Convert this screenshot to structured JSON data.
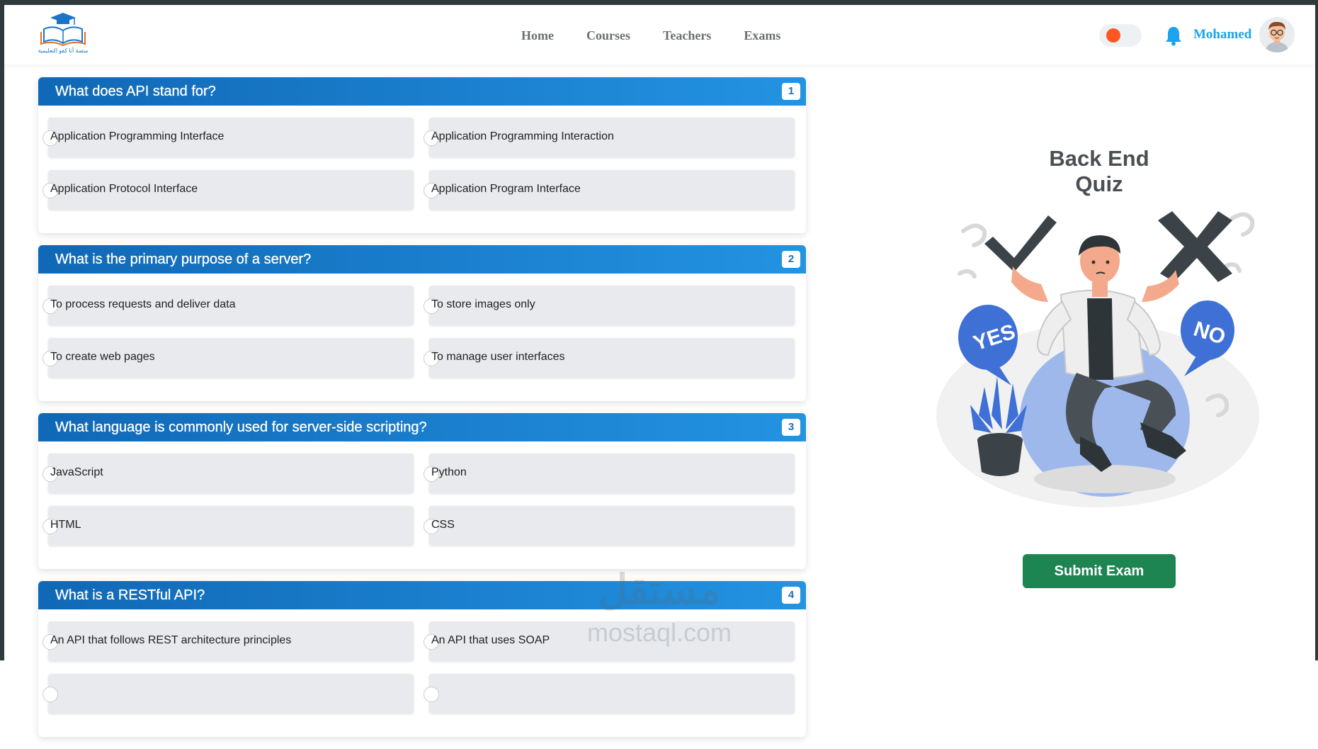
{
  "brand": {
    "logo_text": "منصة أنا كفو التعليمية"
  },
  "nav": {
    "items": [
      {
        "label": "Home"
      },
      {
        "label": "Courses"
      },
      {
        "label": "Teachers"
      },
      {
        "label": "Exams"
      }
    ]
  },
  "user": {
    "name": "Mohamed"
  },
  "colors": {
    "accent": "#1aa3ee",
    "header_gradient_start": "#1068b6",
    "header_gradient_end": "#2393e2",
    "submit": "#1d8551",
    "toggle_knob": "#ff5722"
  },
  "questions": [
    {
      "number": "1",
      "title": "What does API stand for?",
      "options": [
        "Application Programming Interface",
        "Application Programming Interaction",
        "Application Protocol Interface",
        "Application Program Interface"
      ]
    },
    {
      "number": "2",
      "title": "What is the primary purpose of a server?",
      "options": [
        "To process requests and deliver data",
        "To store images only",
        "To create web pages",
        "To manage user interfaces"
      ]
    },
    {
      "number": "3",
      "title": "What language is commonly used for server-side scripting?",
      "options": [
        "JavaScript",
        "Python",
        "HTML",
        "CSS"
      ]
    },
    {
      "number": "4",
      "title": "What is a RESTful API?",
      "options": [
        "An API that follows REST architecture principles",
        "An API that uses SOAP",
        "",
        ""
      ]
    }
  ],
  "sidebar": {
    "title": "Back End Quiz",
    "illustration": {
      "yes_text": "YES",
      "no_text": "NO"
    },
    "submit_label": "Submit Exam"
  },
  "watermark": {
    "arabic": "مستقل",
    "latin": "mostaql.com"
  }
}
